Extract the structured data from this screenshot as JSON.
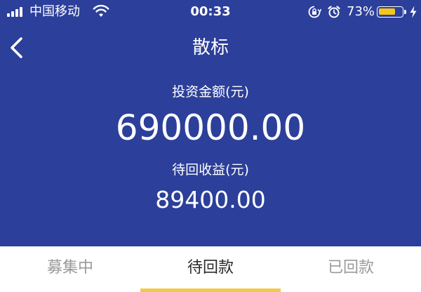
{
  "status_bar": {
    "carrier": "中国移动",
    "time": "00:33",
    "battery_percent": "73%",
    "battery_level": 0.73,
    "battery_color": "#f5c518",
    "icons": [
      "signal-icon",
      "wifi-icon",
      "orientation-lock-icon",
      "alarm-icon",
      "battery-icon",
      "charging-icon"
    ]
  },
  "nav": {
    "title": "散标",
    "back_icon": "chevron-left-icon"
  },
  "summary": {
    "invest_label": "投资金额(元)",
    "invest_value": "690000.00",
    "pending_label": "待回收益(元)",
    "pending_value": "89400.00"
  },
  "tabs": [
    {
      "label": "募集中",
      "active": false
    },
    {
      "label": "待回款",
      "active": true
    },
    {
      "label": "已回款",
      "active": false
    }
  ],
  "colors": {
    "header_bg": "#2c3f9a",
    "tab_indicator": "#f2c94c",
    "tab_active_text": "#2a2a2a",
    "tab_inactive_text": "#9a9a9a"
  }
}
